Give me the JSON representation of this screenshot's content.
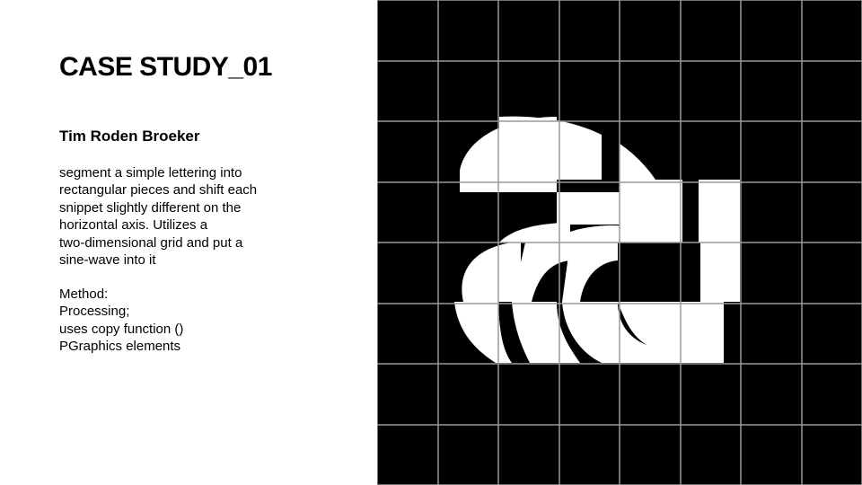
{
  "slide": {
    "title": "CASE STUDY_01",
    "author": "Tim Roden Broeker",
    "description_lines": [
      "segment a simple lettering into",
      "rectangular pieces and shift each",
      "snippet slightly different on the",
      "horizontal axis. Utilizes a",
      "two-dimensional grid and put a",
      "sine-wave into it"
    ],
    "method_lines": [
      "Method:",
      "Processing;",
      "uses copy function ()",
      "PGraphics elements"
    ]
  },
  "artwork": {
    "background_color": "#000000",
    "letter_color": "#ffffff",
    "grid_color": "#9a9a9a",
    "grid_columns": 8,
    "grid_rows": 8
  }
}
